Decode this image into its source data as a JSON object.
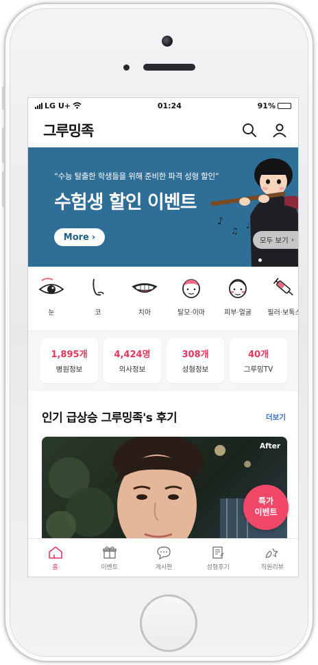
{
  "status_bar": {
    "carrier": "LG U+",
    "time": "01:24",
    "battery": "91%"
  },
  "header": {
    "logo": "그루밍족",
    "icons": [
      "search-icon",
      "user-icon"
    ]
  },
  "banner": {
    "subtitle": "“수능 탈출한 학생들을 위해 준비한 파격 성형 할인”",
    "title": "수험생 할인 이벤트",
    "more_label": "More",
    "see_all_label": "모두 보기"
  },
  "categories": [
    {
      "label": "눈",
      "icon": "eye-icon"
    },
    {
      "label": "코",
      "icon": "nose-icon"
    },
    {
      "label": "치아",
      "icon": "teeth-icon"
    },
    {
      "label": "탈모·이마",
      "icon": "forehead-icon"
    },
    {
      "label": "피부·얼굴",
      "icon": "skin-face-icon"
    },
    {
      "label": "필러·보톡스",
      "icon": "syringe-icon"
    }
  ],
  "stats": [
    {
      "value": "1,895개",
      "label": "병원정보"
    },
    {
      "value": "4,424명",
      "label": "의사정보"
    },
    {
      "value": "308개",
      "label": "성형정보"
    },
    {
      "value": "40개",
      "label": "그루밍TV"
    }
  ],
  "reviews": {
    "title": "인기 급상승 그루밍족's 후기",
    "more_label": "더보기",
    "after_badge": "After"
  },
  "special_event": {
    "line1": "특가",
    "line2": "이벤트"
  },
  "tab_bar": [
    {
      "label": "홈",
      "icon": "home-icon",
      "active": true
    },
    {
      "label": "이벤트",
      "icon": "gift-icon",
      "active": false
    },
    {
      "label": "게시판",
      "icon": "chat-icon",
      "active": false
    },
    {
      "label": "성형후기",
      "icon": "review-icon",
      "active": false
    },
    {
      "label": "직원리뷰",
      "icon": "staff-review-icon",
      "active": false
    }
  ],
  "colors": {
    "accent": "#e8355a",
    "banner_bg": "#2f6e96",
    "link": "#2f6cc8"
  }
}
